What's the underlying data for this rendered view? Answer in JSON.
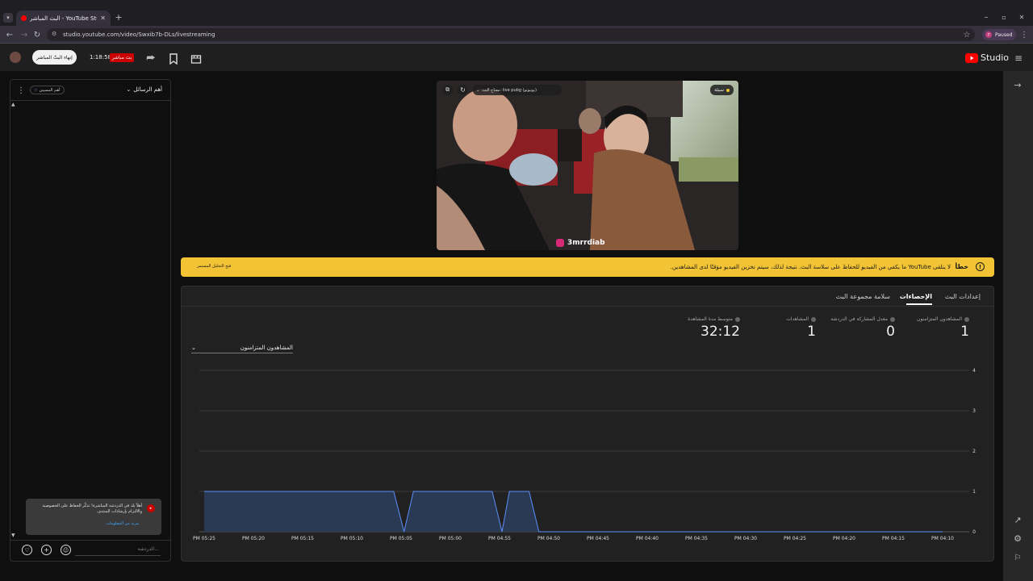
{
  "browser": {
    "tab_title": "البث المباشر - YouTube Studio",
    "url": "studio.youtube.com/video/Swxib7b-DLs/livestreaming",
    "profile_label": "Paused",
    "profile_initial": "z"
  },
  "header": {
    "end_live_label": "إنهاء البثّ المباشر",
    "elapsed": "1:18:58",
    "live_badge": "بث مباشر",
    "studio_label": "Studio"
  },
  "chat": {
    "mode_label": "أهم الرسائل",
    "filter_label": "أهم المسيين",
    "notice_text": "أهلاً بك في الدردشة المباشرة! تذكّر الحفاظ على الخصوصية والالتزام بإرشادات المنتدى.",
    "learn_more": "مزيد من المعلومات",
    "input_placeholder": "الدردشة..."
  },
  "preview": {
    "stream_key_label": "مفتاح البث: live pubg (يوتيوتو)",
    "status_label": "سيئة",
    "instagram_handle": "3mrrdiab"
  },
  "alert": {
    "error_label": "خطأ",
    "message": "لا يتلقى YouTube ما يكفي من الفيديو للحفاظ على سلاسة البث. نتيجة لذلك، سيتم تخزين الفيديو مؤقتًا لدى المشاهدين.",
    "action": "فتح التحليل المستمر"
  },
  "tabs": [
    {
      "label": "إعدادات البث"
    },
    {
      "label": "الإحصاءات"
    },
    {
      "label": "سلامة مجموعة البث"
    }
  ],
  "stats": [
    {
      "label": "المشاهدون المتزامنون",
      "value": "1"
    },
    {
      "label": "معدل المشاركة في الدردشة",
      "value": "0"
    },
    {
      "label": "المشاهدات",
      "value": "1"
    },
    {
      "label": "متوسط مدة المشاهدة",
      "value": "32:12"
    }
  ],
  "metric_select": "المشاهدون المتزامنون",
  "chart_data": {
    "type": "area",
    "x": [
      "PM 05:25",
      "PM 05:20",
      "PM 05:15",
      "PM 05:10",
      "PM 05:05",
      "PM 05:00",
      "PM 04:55",
      "PM 04:50",
      "PM 04:45",
      "PM 04:40",
      "PM 04:35",
      "PM 04:30",
      "PM 04:25",
      "PM 04:20",
      "PM 04:15",
      "PM 04:10"
    ],
    "y_ticks": [
      0,
      1,
      2,
      3,
      4
    ],
    "ylim": [
      0,
      4
    ],
    "series": [
      {
        "values_t": [
          [
            0,
            1
          ],
          [
            1,
            1
          ],
          [
            2,
            1
          ],
          [
            3,
            1
          ],
          [
            3.85,
            1
          ],
          [
            4.06,
            0
          ],
          [
            4.25,
            1
          ],
          [
            5,
            1
          ],
          [
            5.85,
            1
          ],
          [
            6.05,
            0
          ],
          [
            6.2,
            1
          ],
          [
            6.6,
            1
          ],
          [
            6.8,
            0
          ],
          [
            7,
            0
          ],
          [
            8,
            0
          ],
          [
            9,
            0
          ],
          [
            10,
            0
          ],
          [
            11,
            0
          ],
          [
            12,
            0
          ],
          [
            13,
            0
          ],
          [
            14,
            0
          ],
          [
            15,
            0
          ]
        ]
      }
    ],
    "colors": {
      "line": "#5b8ff9",
      "fill": "#2a3a55"
    }
  }
}
